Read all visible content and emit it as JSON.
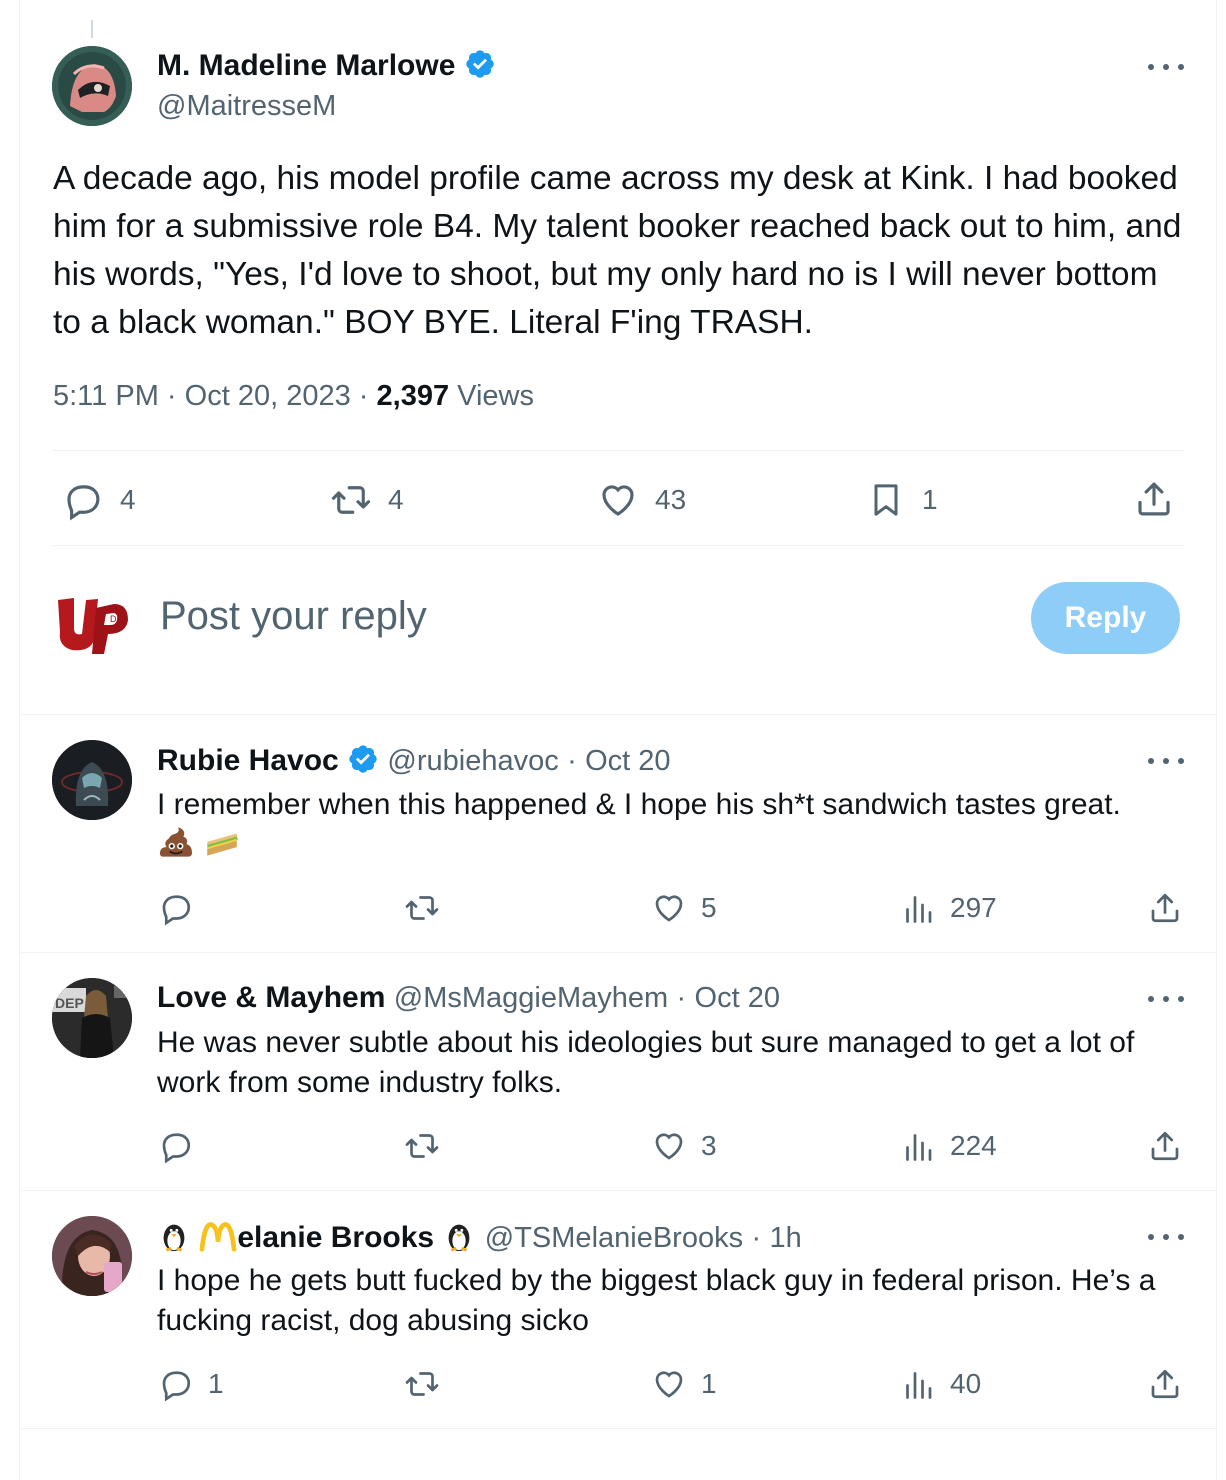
{
  "main_tweet": {
    "author": {
      "name": "M. Madeline Marlowe",
      "handle": "@MaitresseM",
      "verified": true,
      "avatar_icon": "avatar-pink-hood"
    },
    "text": "A decade ago, his model profile came across my desk at Kink. I had booked him for a submissive role B4. My talent booker reached back out to him, and his words, \"Yes, I'd love to shoot, but my only hard no is I will never bottom to a black woman.\" BOY BYE. Literal F'ing TRASH.",
    "time": "5:11 PM",
    "date": "Oct 20, 2023",
    "views_count": "2,397",
    "views_label": "Views",
    "separator": "·",
    "actions": {
      "replies": "4",
      "reposts": "4",
      "likes": "43",
      "bookmarks": "1"
    }
  },
  "compose": {
    "placeholder": "Post your reply",
    "button": "Reply",
    "avatar_icon": "avatar-up-logo"
  },
  "replies": [
    {
      "name": "Rubie Havoc",
      "verified": true,
      "handle": "@rubiehavoc",
      "time": "Oct 20",
      "text": "I remember when this happened & I hope his sh*t sandwich tastes great.",
      "emojis": [
        "pile-of-poo",
        "sandwich"
      ],
      "replies": "",
      "reposts": "",
      "likes": "5",
      "views": "297"
    },
    {
      "name": "Love & Mayhem",
      "verified": false,
      "handle": "@MsMaggieMayhem",
      "time": "Oct 20",
      "text": "He was never subtle about his ideologies but sure managed to get a lot of work from some industry folks.",
      "replies": "",
      "reposts": "",
      "likes": "3",
      "views": "224"
    },
    {
      "name": "elanie Brooks",
      "name_prefix_icons": [
        "penguin",
        "m-logo"
      ],
      "name_suffix_icon": "penguin",
      "verified": false,
      "handle": "@TSMelanieBrooks",
      "time": "1h",
      "text": "I hope he gets butt fucked by the biggest black guy in federal prison. He’s a fucking racist, dog abusing sicko",
      "replies": "1",
      "reposts": "",
      "likes": "1",
      "views": "40"
    }
  ],
  "colors": {
    "text_primary": "#0f1419",
    "text_secondary": "#536471",
    "verified_blue": "#1d9bf0",
    "reply_button_disabled": "#8ecdf8",
    "divider": "#eff3f4"
  }
}
